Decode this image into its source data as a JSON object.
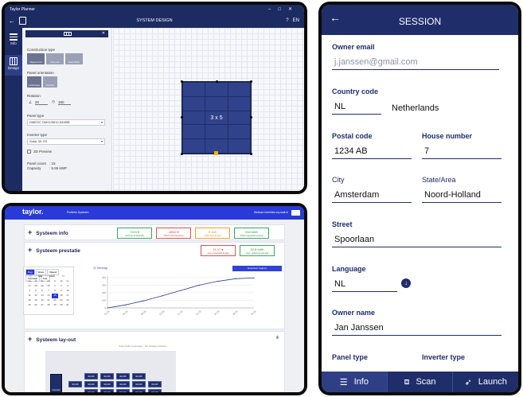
{
  "colors": {
    "brand_navy": "#1f2d6b",
    "portal_blue": "#2a3ad8",
    "canvas_grid": "#e3e6ef"
  },
  "desktop": {
    "window_title": "Taylor Planner",
    "window_controls": [
      "–",
      "□",
      "✕"
    ],
    "screen_title": "SYSTEM DESIGN",
    "help": "?",
    "language": "EN",
    "nav": [
      {
        "label": "Info",
        "icon": "list-icon"
      },
      {
        "label": "Design",
        "icon": "grid-icon"
      }
    ],
    "sidebar": {
      "close": "✕",
      "construction_type_label": "Construction type",
      "construction_options": [
        "Sloped roof",
        "Flat roof",
        "East-West"
      ],
      "panel_orientation_label": "Panel orientation",
      "orientation_options": [
        "Landscape",
        "Portrait"
      ],
      "rotation_label": "Rotation",
      "rotation_values": [
        "20",
        "180"
      ],
      "panel_type_label": "Panel type",
      "panel_type_value": "DMEGC DM410M10-54HBB",
      "inverter_type_label": "Inverter type",
      "inverter_type_value": "Sofar 3K G3",
      "preview_label": "3D Preview",
      "panel_count_label": "Panel count",
      "panel_count_value": ": 15",
      "capacity_label": "Capacity",
      "capacity_value": ": 5.55 kWP"
    },
    "array_label": "3 x 5"
  },
  "portal": {
    "logo": "taylor.",
    "nav": "Portfolio    Systeem",
    "user": "Welkom  heinhiks.uiq.mail.nl",
    "sections": {
      "info_title": "Systeem info",
      "performance_title": "Systeem prestatie",
      "layout_title": "Systeem lay-out"
    },
    "info_kpis": [
      {
        "value": "7219 ▾",
        "caption": "Verbruik dit kwartaal",
        "tone": "green"
      },
      {
        "value": "-8342 ▾",
        "caption": "Totaal CO2 besparing",
        "tone": "red"
      },
      {
        "value": "€ 100",
        "caption": "Opbrengst dit jaar",
        "tone": "orange"
      },
      {
        "value": "918 kWh",
        "caption": "Totaal opgewekte energie",
        "tone": "green"
      }
    ],
    "perf_kpis": [
      {
        "value": "11,17 ▾",
        "caption": "Gem. opgewekt dit jaar",
        "tone": "red"
      },
      {
        "value": "22,8 kWh",
        "caption": "Gem. opbrengst per dag",
        "tone": "green"
      }
    ],
    "export_button": "Exporteer rapport",
    "calendar": {
      "tabs": [
        "Dag",
        "Week",
        "Maand",
        "Kwartaal",
        "Jaar"
      ],
      "month_row": [
        "<<",
        "Mei",
        "2020",
        ">>"
      ],
      "weekdays": [
        "ma",
        "di",
        "wo",
        "do",
        "vr",
        "za",
        "zo"
      ],
      "days": [
        "27",
        "28",
        "29",
        "30",
        "1",
        "2",
        "3",
        "4",
        "5",
        "6",
        "7",
        "8",
        "9",
        "10",
        "11",
        "12",
        "13",
        "14",
        "15",
        "16",
        "17",
        "18",
        "19",
        "20",
        "21",
        "22",
        "23",
        "24",
        "25",
        "26",
        "27",
        "28",
        "29",
        "30",
        "31"
      ],
      "selected_index": 18
    },
    "chart_title": "Verloop",
    "layout_meta": "Zoek DGB s huisnaam  ·  Zet huidige machten",
    "inverter_label": "Inverter",
    "panel_label": "000 Wh"
  },
  "mobile": {
    "title": "SESSION",
    "fields": {
      "owner_email_label": "Owner email",
      "owner_email_value": "j.janssen@gmail.com",
      "country_code_label": "Country code",
      "country_code_value": "NL",
      "country_name": "Netherlands",
      "postal_code_label": "Postal code",
      "postal_code_value": "1234 AB",
      "house_number_label": "House number",
      "house_number_value": "7",
      "city_label": "City",
      "city_value": "Amsterdam",
      "state_label": "State/Area",
      "state_value": "Noord-Holland",
      "street_label": "Street",
      "street_value": "Spoorlaan",
      "language_label": "Language",
      "language_value": "NL",
      "owner_name_label": "Owner name",
      "owner_name_value": "Jan Janssen",
      "panel_type_label": "Panel type",
      "inverter_type_label": "Inverter type"
    },
    "footer": {
      "info": "Info",
      "scan": "Scan",
      "launch": "Launch"
    }
  },
  "chart_data": {
    "type": "line",
    "x": [
      "01-05",
      "05-05",
      "09-05",
      "13-05",
      "17-05",
      "21-05",
      "25-05",
      "29-05",
      "31-05"
    ],
    "series": [
      {
        "values": [
          0,
          40,
          95,
          160,
          230,
          300,
          350,
          385,
          395
        ]
      }
    ],
    "y_ticks": [
      "0",
      "100",
      "200",
      "300",
      "400"
    ],
    "ylim": [
      0,
      420
    ]
  }
}
